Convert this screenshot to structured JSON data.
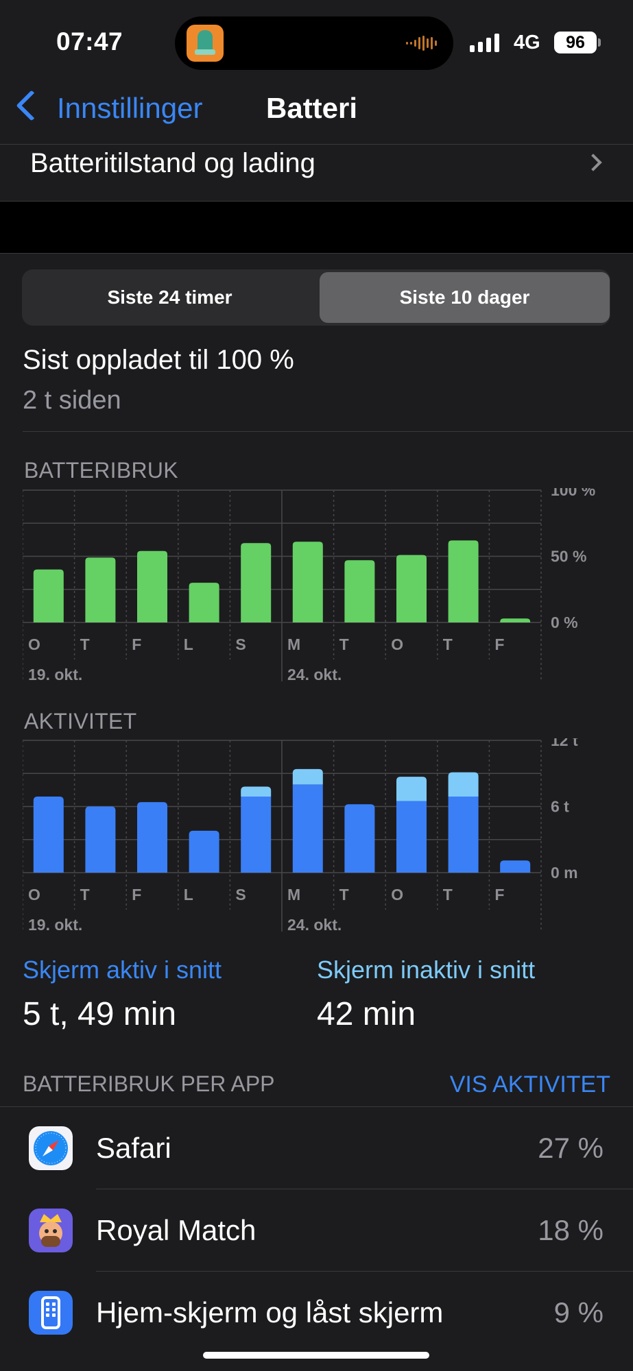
{
  "status": {
    "time": "07:47",
    "network": "4G",
    "battery_level": "96",
    "signal_bars": 4
  },
  "nav": {
    "back_label": "Innstillinger",
    "title": "Batteri"
  },
  "health_row": {
    "label": "Batteritilstand og lading"
  },
  "segmented": {
    "options": [
      "Siste 24 timer",
      "Siste 10 dager"
    ],
    "selected": "Siste 10 dager"
  },
  "last_charged": {
    "title": "Sist oppladet til 100 %",
    "subtitle": "2 t siden"
  },
  "colors": {
    "accent": "#3a87f5",
    "battery_bar": "#65d064",
    "activity_active": "#3a7ff6",
    "activity_inactive": "#7ecbfa",
    "secondary_text": "#98989f"
  },
  "chart_data": [
    {
      "type": "bar",
      "title": "BATTERIBRUK",
      "categories": [
        "O",
        "T",
        "F",
        "L",
        "S",
        "M",
        "T",
        "O",
        "T",
        "F"
      ],
      "date_labels": [
        {
          "index": 0,
          "text": "19. okt."
        },
        {
          "index": 5,
          "text": "24. okt."
        }
      ],
      "values": [
        40,
        49,
        54,
        30,
        60,
        61,
        47,
        51,
        62,
        3
      ],
      "ylim": [
        0,
        100
      ],
      "yticks": [
        "100 %",
        "50 %",
        "0 %"
      ],
      "ytick_values": [
        100,
        50,
        0
      ],
      "grid": true
    },
    {
      "type": "bar",
      "stacked": true,
      "title": "AKTIVITET",
      "categories": [
        "O",
        "T",
        "F",
        "L",
        "S",
        "M",
        "T",
        "O",
        "T",
        "F"
      ],
      "date_labels": [
        {
          "index": 0,
          "text": "19. okt."
        },
        {
          "index": 5,
          "text": "24. okt."
        }
      ],
      "series": [
        {
          "name": "Skjerm aktiv",
          "values": [
            6.9,
            6.0,
            6.4,
            3.8,
            6.9,
            8.0,
            6.2,
            6.5,
            6.9,
            1.1
          ]
        },
        {
          "name": "Skjerm inaktiv",
          "values": [
            0,
            0,
            0,
            0,
            0.9,
            1.4,
            0,
            2.2,
            2.2,
            0
          ]
        }
      ],
      "ylim": [
        0,
        12
      ],
      "yticks": [
        "12 t",
        "6 t",
        "0 m"
      ],
      "ytick_values": [
        12,
        6,
        0
      ],
      "grid": true
    }
  ],
  "stats": {
    "active_label": "Skjerm aktiv i snitt",
    "active_value": "5 t, 49 min",
    "inactive_label": "Skjerm inaktiv i snitt",
    "inactive_value": "42 min"
  },
  "apps_section": {
    "header": "BATTERIBRUK PER APP",
    "action": "VIS AKTIVITET",
    "items": [
      {
        "name": "Safari",
        "percent": "27 %",
        "icon": "safari-icon"
      },
      {
        "name": "Royal Match",
        "percent": "18 %",
        "icon": "royal-match-icon"
      },
      {
        "name": "Hjem-skjerm og låst skjerm",
        "percent": "9 %",
        "icon": "home-screen-icon"
      }
    ]
  }
}
